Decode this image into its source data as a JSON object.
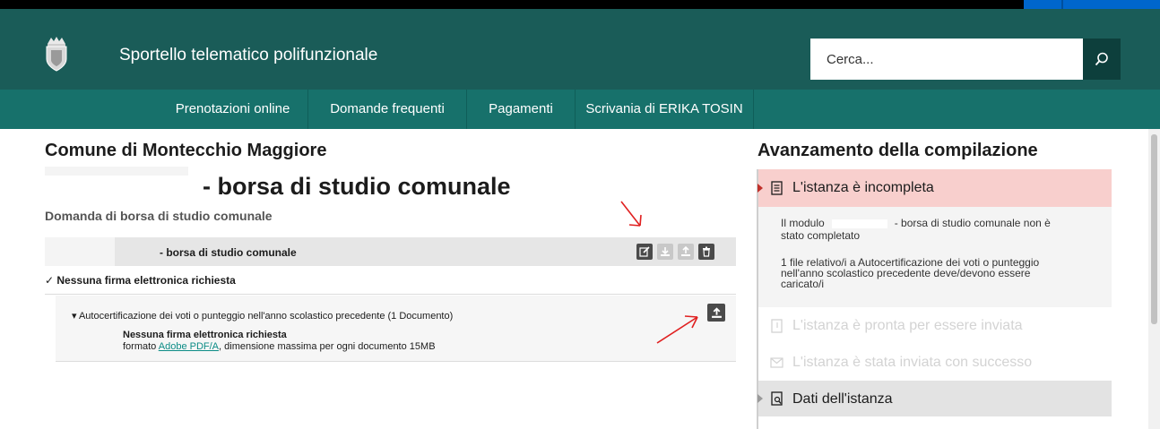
{
  "header": {
    "site_title": "Sportello telematico polifunzionale",
    "search_placeholder": "Cerca..."
  },
  "nav": {
    "items": [
      "Prenotazioni online",
      "Domande frequenti",
      "Pagamenti",
      "Scrivania di ERIKA TOSIN"
    ]
  },
  "main": {
    "ente": "Comune di Montecchio Maggiore",
    "modulo_title": "- borsa di studio comunale",
    "subtitle": "Domanda di borsa di studio comunale",
    "doc_header_title": "- borsa di studio comunale",
    "firma": "✓ Nessuna firma elettronica richiesta",
    "allegato_title": "▾ Autocertificazione dei voti o punteggio nell'anno scolastico precedente (1 Documento)",
    "allegato_firma": "Nessuna firma elettronica richiesta",
    "allegato_formato_prefix": "formato ",
    "allegato_formato_link": "Adobe PDF/A",
    "allegato_formato_suffix": ", dimensione massima per ogni documento 15MB"
  },
  "side": {
    "title": "Avanzamento della compilazione",
    "status_incomplete": "L'istanza è incompleta",
    "msg1_prefix": "Il modulo",
    "msg1_suffix": "- borsa di studio comunale non è",
    "msg1_line2": "stato completato",
    "msg2_line1": "1 file relativo/i a Autocertificazione dei voti o punteggio",
    "msg2_line2": "nell'anno scolastico precedente deve/devono essere",
    "msg2_line3": "caricato/i",
    "status_ready": "L'istanza è pronta per essere inviata",
    "status_sent": "L'istanza è stata inviata con successo",
    "dati": "Dati dell'istanza"
  },
  "colors": {
    "header_bg": "#1a5c58",
    "nav_bg": "#17716b",
    "incomplete_bg": "#f8cfcd",
    "arrow": "#e02020"
  }
}
